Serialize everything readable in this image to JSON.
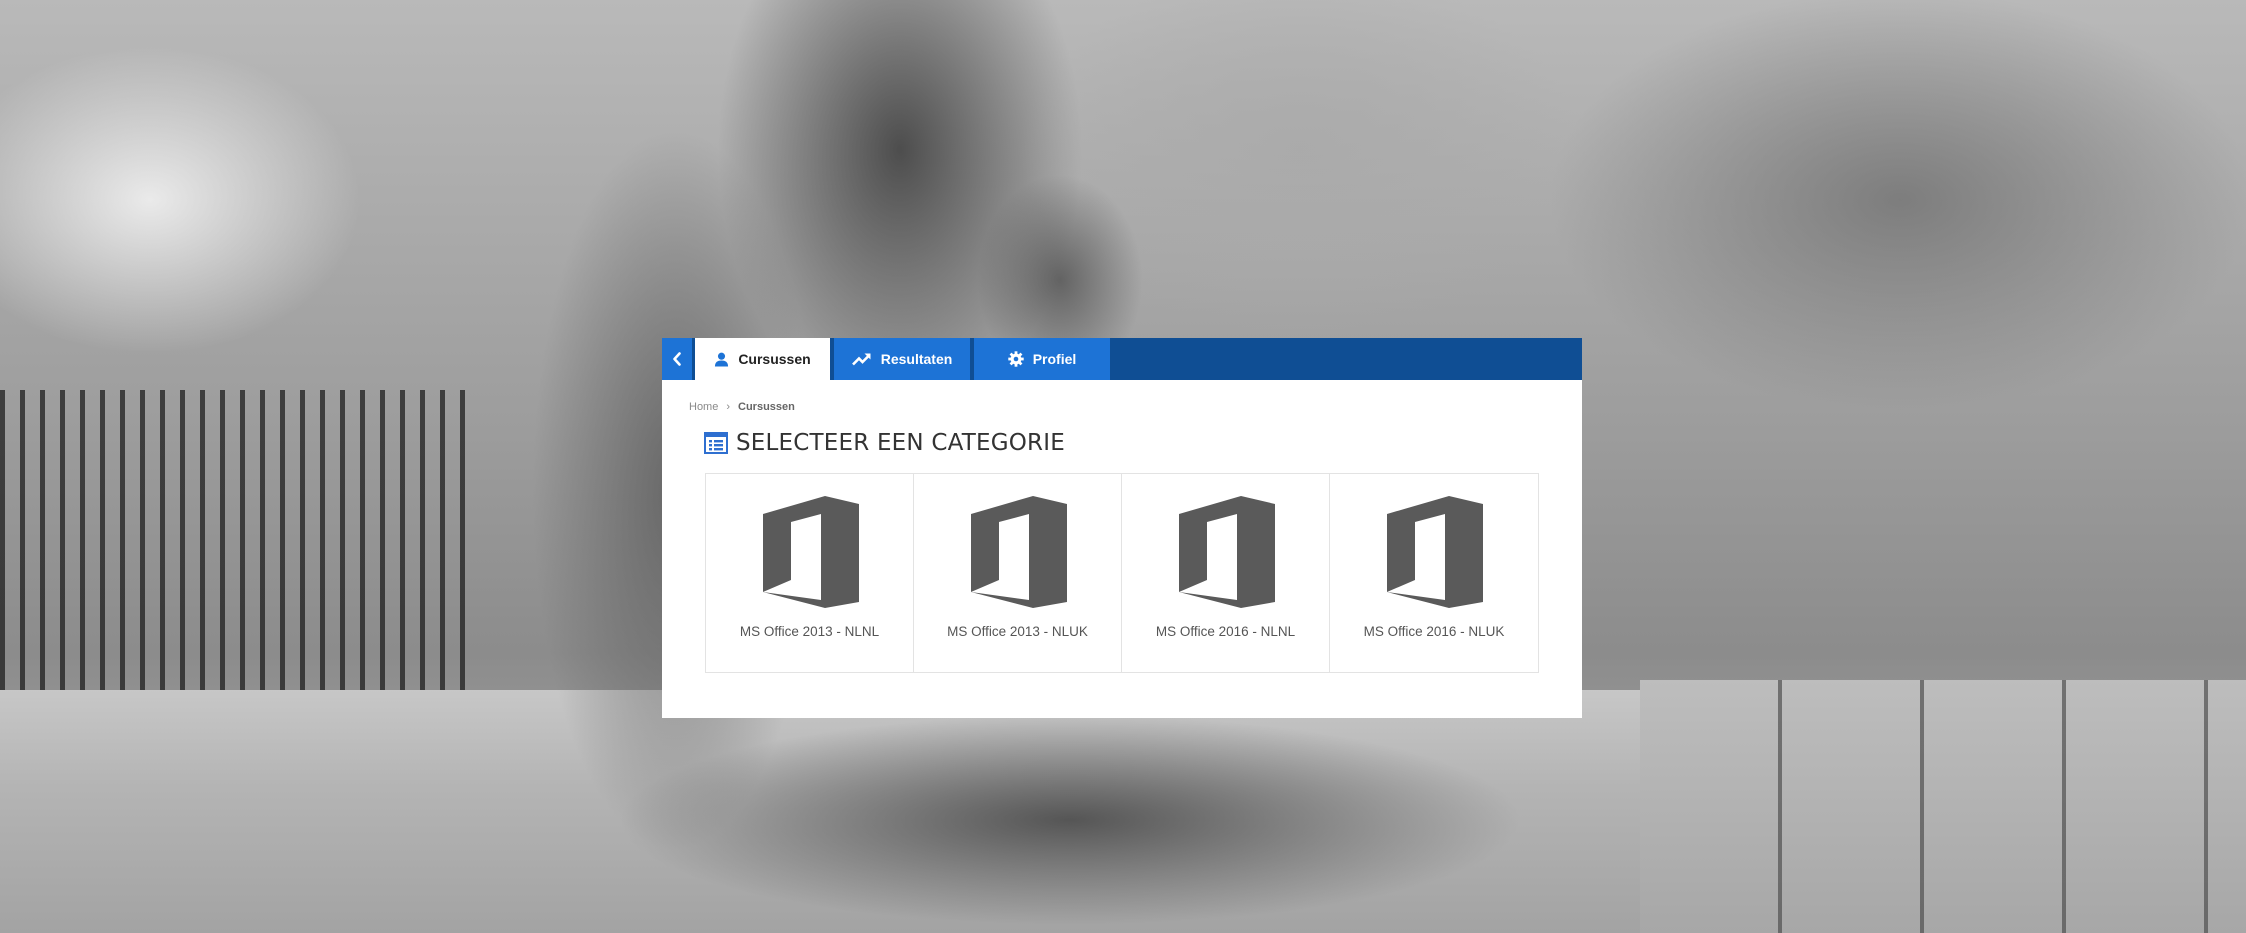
{
  "nav": {
    "tabs": [
      {
        "label": "Cursussen",
        "icon": "user-icon",
        "active": true
      },
      {
        "label": "Resultaten",
        "icon": "trend-chart-icon",
        "active": false
      },
      {
        "label": "Profiel",
        "icon": "gear-icon",
        "active": false
      }
    ],
    "back_icon": "chevron-left-icon"
  },
  "breadcrumb": {
    "home": "Home",
    "separator": "›",
    "current": "Cursussen"
  },
  "page": {
    "title": "SELECTEER EEN CATEGORIE",
    "title_icon": "list-icon"
  },
  "categories": [
    {
      "label": "MS Office 2013 - NLNL",
      "icon": "office-logo-icon"
    },
    {
      "label": "MS Office 2013 - NLUK",
      "icon": "office-logo-icon"
    },
    {
      "label": "MS Office 2016 - NLNL",
      "icon": "office-logo-icon"
    },
    {
      "label": "MS Office 2016 - NLUK",
      "icon": "office-logo-icon"
    }
  ],
  "colors": {
    "navbar": "#0f4e94",
    "tab": "#1d73d6",
    "active_tab": "#ffffff",
    "logo": "#5a5a5a"
  }
}
